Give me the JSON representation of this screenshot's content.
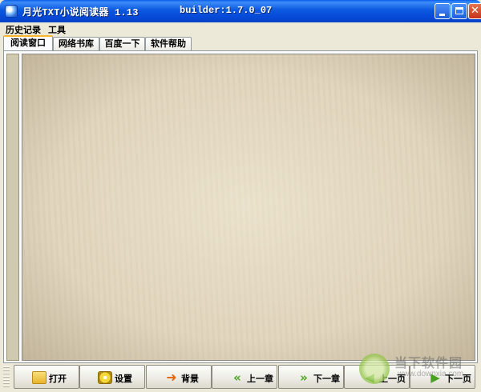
{
  "window": {
    "title": "月光TXT小说阅读器 1.13",
    "build": "builder:1.7.0_07"
  },
  "menu": {
    "history": "历史记录",
    "tools": "工具"
  },
  "tabs": [
    {
      "label": "阅读窗口",
      "active": true
    },
    {
      "label": "网络书库",
      "active": false
    },
    {
      "label": "百度一下",
      "active": false
    },
    {
      "label": "软件帮助",
      "active": false
    }
  ],
  "toolbar": {
    "open": "打开",
    "settings": "设置",
    "background": "背景",
    "prev_chapter": "上一章",
    "next_chapter": "下一章",
    "prev_page": "上一页",
    "next_page": "下一页"
  },
  "icons": {
    "open": "folder-open-icon",
    "settings": "settings-icon",
    "background": "refresh-arrow-icon",
    "prev_chapter": "double-left-arrow-icon",
    "next_chapter": "double-right-arrow-icon",
    "prev_page": "left-arrow-icon",
    "next_page": "right-arrow-icon"
  },
  "watermark": {
    "name": "当下软件园",
    "url": "www.downxia.com"
  },
  "colors": {
    "titlebar": "#0a5ee8",
    "paper": "#e0d5bc",
    "tab_accent": "#f9b62d"
  }
}
